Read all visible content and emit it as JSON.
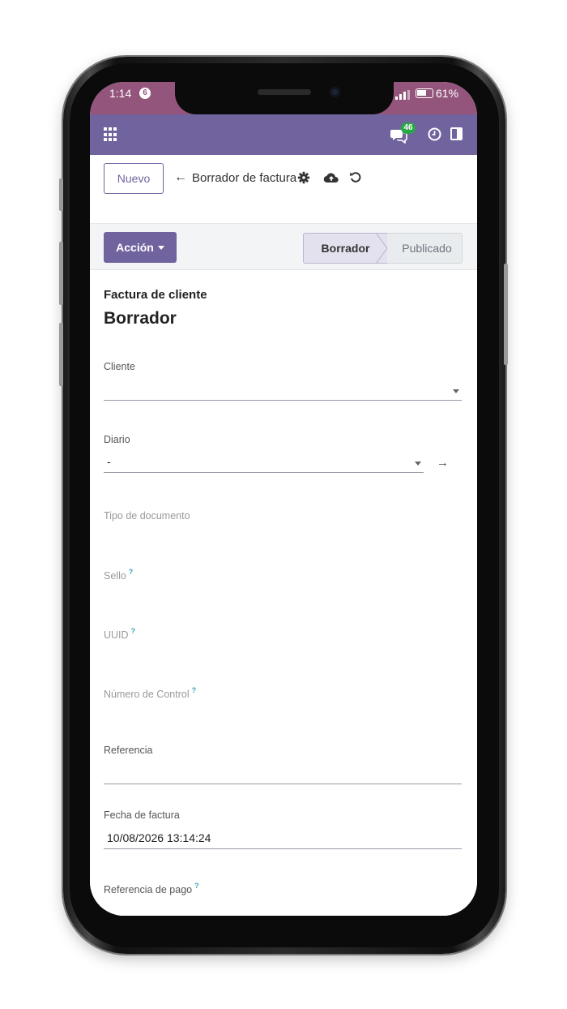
{
  "status_bar": {
    "time": "1:14",
    "notification_count": "6",
    "battery": "61%"
  },
  "navbar": {
    "chat_badge": "46"
  },
  "control_panel": {
    "new_button": "Nuevo",
    "breadcrumb": "Borrador de factura"
  },
  "action_bar": {
    "action_button": "Acción",
    "stages": [
      "Borrador",
      "Publicado"
    ],
    "active_stage": "Borrador"
  },
  "form": {
    "document_type": "Factura de cliente",
    "state_title": "Borrador",
    "fields": {
      "customer": {
        "label": "Cliente",
        "value": ""
      },
      "journal": {
        "label": "Diario",
        "value": "-"
      },
      "document_type": {
        "label": "Tipo de documento"
      },
      "seal": {
        "label": "Sello",
        "help": "?"
      },
      "uuid": {
        "label": "UUID",
        "help": "?"
      },
      "control_number": {
        "label": "Número de Control",
        "help": "?"
      },
      "reference": {
        "label": "Referencia",
        "value": ""
      },
      "invoice_date": {
        "label": "Fecha de factura",
        "value": "10/08/2026 13:14:24"
      },
      "payment_reference": {
        "label": "Referencia de pago",
        "help": "?"
      }
    }
  },
  "colors": {
    "status_bar": "#94557c",
    "navbar": "#71639e",
    "primary": "#71639e",
    "chat_badge": "#28a745"
  }
}
